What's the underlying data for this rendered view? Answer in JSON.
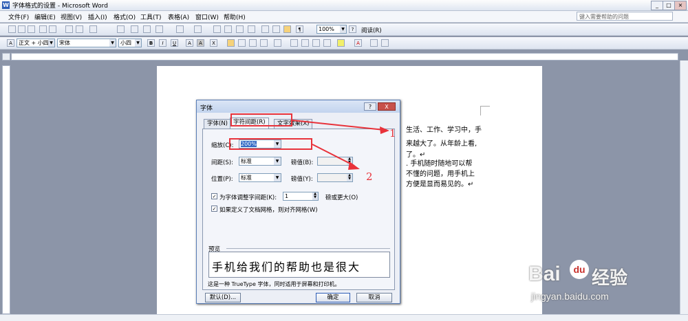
{
  "window": {
    "title": "字体格式的设置 - Microsoft Word",
    "app_letter": "W"
  },
  "menu": {
    "items": [
      "文件(F)",
      "编辑(E)",
      "视图(V)",
      "插入(I)",
      "格式(O)",
      "工具(T)",
      "表格(A)",
      "窗口(W)",
      "帮助(H)"
    ],
    "help_placeholder": "键入需要帮助的问题"
  },
  "toolbar": {
    "zoom": "100%",
    "reading": "阅读(R)",
    "font_label": "A"
  },
  "format_bar": {
    "style": "正文 + 小四",
    "font": "宋体",
    "size": "小四"
  },
  "document": {
    "lines": [
      "生活、工作、学习中，手",
      "来越大了。从年龄上看,",
      "了。↵",
      ". 手机随时随地可以帮",
      "不懂的问题，用手机上",
      "方便是显而易见的。↵"
    ]
  },
  "dialog": {
    "title": "字体",
    "help": "?",
    "close": "X",
    "tabs": [
      "字体(N)",
      "字符间距(R)",
      "文字效果(X)"
    ],
    "scale": {
      "label": "缩放(C):",
      "value": "200%"
    },
    "spacing": {
      "label": "间距(S):",
      "value": "标准",
      "by_label": "磅值(B):"
    },
    "position": {
      "label": "位置(P):",
      "value": "标准",
      "by_label": "磅值(Y):"
    },
    "kerning": {
      "label": "为字体调整字间距(K):",
      "value": "1",
      "suffix": "磅或更大(O)",
      "check": "✓"
    },
    "grid": {
      "label": "如果定义了文档网格，则对齐网格(W)",
      "check": "✓"
    },
    "preview": {
      "label": "预览",
      "text": "手机给我们的帮助也是很大"
    },
    "note": "这是一种 TrueType 字体，同时适用于屏幕和打印机。",
    "buttons": {
      "default": "默认(D)...",
      "ok": "确定",
      "cancel": "取消"
    }
  },
  "annotations": {
    "one": "1",
    "two": "2",
    "color": "#e8323a"
  },
  "watermark": {
    "brand": "Bai",
    "paw": "du",
    "suffix": "经验",
    "url": "jingyan.baidu.com"
  }
}
